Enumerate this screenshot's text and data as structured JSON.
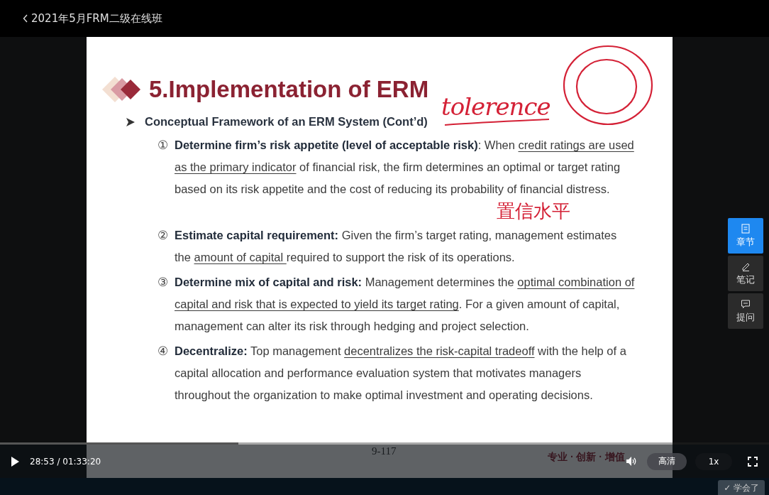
{
  "header": {
    "title": "2021年5月FRM二级在线班"
  },
  "slide": {
    "title": "5.Implementation of ERM",
    "subheading": "Conceptual Framework of an ERM System (Cont’d)",
    "items": [
      {
        "number": "①",
        "segments": [
          {
            "text": "Determine firm’s risk appetite (level of acceptable risk)",
            "kind": "bold"
          },
          {
            "text": ": When ",
            "kind": "plain"
          },
          {
            "text": "credit ratings are used as the primary indicator",
            "kind": "underline"
          },
          {
            "text": " of financial risk, the firm determines an optimal or target rating based on its risk appetite and the cost of reducing its probability of financial distress.",
            "kind": "plain"
          }
        ]
      },
      {
        "number": "②",
        "segments": [
          {
            "text": "Estimate capital requirement:",
            "kind": "bold"
          },
          {
            "text": " Given the firm’s target rating, management estimates the ",
            "kind": "plain"
          },
          {
            "text": "amount of capital ",
            "kind": "underline"
          },
          {
            "text": "required to support the risk of its operations.",
            "kind": "plain"
          }
        ]
      },
      {
        "number": "③",
        "segments": [
          {
            "text": "Determine mix of capital and risk:",
            "kind": "bold"
          },
          {
            "text": " Management determines the ",
            "kind": "plain"
          },
          {
            "text": "optimal combination of capital and risk that is expected to yield its target rating",
            "kind": "underline"
          },
          {
            "text": ". For a given amount of capital, management can alter its risk through hedging and project selection.",
            "kind": "plain"
          }
        ]
      },
      {
        "number": "④",
        "segments": [
          {
            "text": "Decentralize:",
            "kind": "bold"
          },
          {
            "text": " Top management ",
            "kind": "plain"
          },
          {
            "text": "decentralizes the risk-capital tradeoff",
            "kind": "underline"
          },
          {
            "text": " with the help of a capital allocation and performance evaluation system that motivates managers throughout the organization to make optimal investment and operating decisions.",
            "kind": "plain"
          }
        ]
      }
    ],
    "page_number": "9-117",
    "tagline": "专业 · 创新 · 增值",
    "annotations": [
      {
        "text": "tolerence"
      },
      {
        "text": "置信水平"
      }
    ]
  },
  "side_tabs": [
    {
      "label": "章节",
      "selected": true
    },
    {
      "label": "笔记",
      "selected": false
    },
    {
      "label": "提问",
      "selected": false
    }
  ],
  "player": {
    "time": "28:53 / 01:33:20",
    "progress": {
      "level": 0.31
    },
    "quality": "高清",
    "speed": "1x"
  },
  "learned_button": "✓ 学会了"
}
